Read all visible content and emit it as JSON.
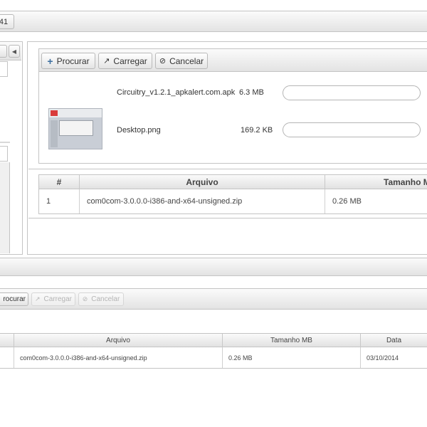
{
  "top": {
    "tab_label": "41"
  },
  "left_panel": {
    "collapse_glyph": "◀"
  },
  "upload_toolbar": {
    "browse_label": "Procurar",
    "upload_label": "Carregar",
    "cancel_label": "Cancelar"
  },
  "queue": [
    {
      "name": "Circuitry_v1.2.1_apkalert.com.apk",
      "size": "6.3 MB",
      "progress": 0,
      "has_thumbnail": false
    },
    {
      "name": "Desktop.png",
      "size": "169.2 KB",
      "progress": 0,
      "has_thumbnail": true
    }
  ],
  "files_table": {
    "columns": [
      "#",
      "Arquivo",
      "Tamanho MB"
    ],
    "rows": [
      {
        "index": "1",
        "file": "com0com-3.0.0.0-i386-and-x64-unsigned.zip",
        "size": "0.26 MB"
      }
    ]
  },
  "bottom_toolbar": {
    "browse_label": "rocurar",
    "upload_label": "Carregar",
    "cancel_label": "Cancelar"
  },
  "bottom_table": {
    "columns": [
      "Arquivo",
      "Tamanho MB",
      "Data"
    ],
    "rows": [
      {
        "file": "com0com-3.0.0.0-i386-and-x64-unsigned.zip",
        "size": "0.26 MB",
        "date": "03/10/2014"
      }
    ]
  },
  "colors": {
    "border": "#c4c4c4",
    "header_start": "#fbfbfb",
    "header_end": "#e3e3e3",
    "plus_icon": "#3c6e9f"
  }
}
